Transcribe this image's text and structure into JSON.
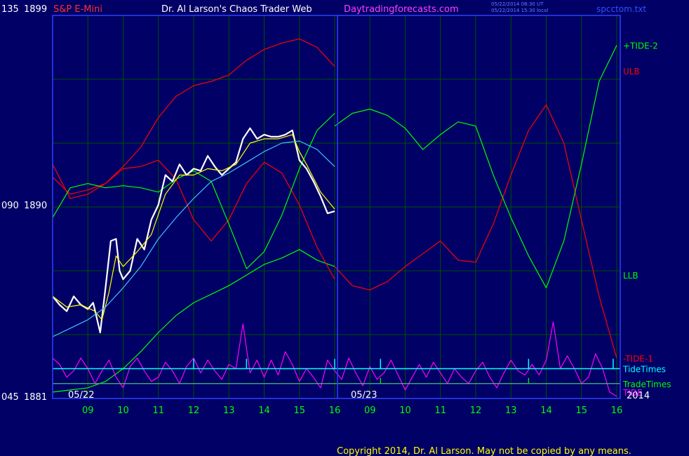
{
  "header": {
    "instrument": "S&P E-Mini",
    "title": "Dr. Al Larson's Chaos Trader Web",
    "site": "Daytradingforecasts.com",
    "timestamp1": "05/22/2014 08:30 UT",
    "timestamp2": "05/22/2014 15:30 local",
    "file": "spcctom.txt"
  },
  "copyright": "Copyright 2014, Dr. Al Larson. May not be copied by any means.",
  "colors": {
    "background": "#000066",
    "grid": "#005000",
    "frame": "#3040ff",
    "red": "#ff0000",
    "green": "#00ff00",
    "magenta": "#ff00ff",
    "cyan": "#00ffff",
    "white": "#ffffff",
    "yellow": "#ffff00",
    "lightblue": "#40c0ff",
    "label_white": "#ffffff"
  },
  "chart_data": {
    "type": "line",
    "ylim": [
      1881,
      1899
    ],
    "y_tick_labels": [
      {
        "value": 1899,
        "code": "135",
        "label": "1899"
      },
      {
        "value": 1890,
        "code": "090",
        "label": "1890"
      },
      {
        "value": 1881,
        "code": "045",
        "label": "1881"
      }
    ],
    "x_range": [
      8.1,
      16.1
    ],
    "x_tick_labels": [
      "09",
      "10",
      "11",
      "12",
      "13",
      "14",
      "15",
      "16",
      "09",
      "10",
      "11",
      "12",
      "13",
      "14",
      "15",
      "16"
    ],
    "date_labels": [
      "05/22",
      "05/23"
    ],
    "year_label": "2014",
    "right_labels": [
      {
        "text": "+TIDE-2",
        "color": "green",
        "y": 1897.6
      },
      {
        "text": "ULB",
        "color": "red",
        "y": 1896.4
      },
      {
        "text": "LLB",
        "color": "green",
        "y": 1886.8
      },
      {
        "text": "-TIDE-1",
        "color": "red",
        "y": 1882.9
      },
      {
        "text": "TideTimes",
        "color": "cyan",
        "y": 1882.4
      },
      {
        "text": "TradeTimes",
        "color": "green",
        "y": 1881.7
      },
      {
        "text": "TIDE",
        "color": "magenta",
        "y": 1881.3
      }
    ],
    "series": [
      {
        "name": "ULB",
        "color": "red",
        "x": [
          8.0,
          8.5,
          9.0,
          9.5,
          10.0,
          10.5,
          11.0,
          11.5,
          12.0,
          12.5,
          13.0,
          13.5,
          14.0,
          14.5,
          15.0,
          15.5,
          16.0
        ],
        "y": [
          1892.0,
          1890.4,
          1890.6,
          1891.1,
          1891.9,
          1892.8,
          1894.2,
          1895.2,
          1895.7,
          1895.9,
          1896.2,
          1896.9,
          1897.4,
          1897.7,
          1897.9,
          1897.5,
          1896.6
        ]
      },
      {
        "name": "LLB",
        "color": "green",
        "x": [
          8.0,
          8.5,
          9.0,
          9.5,
          10.0,
          10.5,
          11.0,
          11.5,
          12.0,
          12.5,
          13.0,
          13.5,
          14.0,
          14.5,
          15.0,
          15.5,
          16.0
        ],
        "y": [
          1881.3,
          1881.4,
          1881.5,
          1881.8,
          1882.4,
          1883.2,
          1884.1,
          1884.9,
          1885.5,
          1885.9,
          1886.3,
          1886.8,
          1887.3,
          1887.6,
          1888.0,
          1887.5,
          1887.2
        ]
      },
      {
        "name": "LLB (forecast)",
        "color": "red",
        "x": [
          16.0,
          16.5,
          17.0,
          17.5,
          18.0,
          18.5,
          19.0,
          19.5,
          20.0,
          20.5,
          21.0,
          21.5,
          22.0,
          22.5,
          23.0,
          23.5,
          24.0
        ],
        "y": [
          1887.2,
          1886.3,
          1886.1,
          1886.5,
          1887.2,
          1887.8,
          1888.4,
          1887.5,
          1887.4,
          1889.2,
          1891.5,
          1893.6,
          1894.8,
          1893.0,
          1889.4,
          1885.8,
          1882.9
        ]
      },
      {
        "name": "+TIDE-2 (forecast)",
        "color": "green",
        "x": [
          16.0,
          16.5,
          17.0,
          17.5,
          18.0,
          18.5,
          19.0,
          19.5,
          20.0,
          20.5,
          21.0,
          21.5,
          22.0,
          22.5,
          23.0,
          23.5,
          24.0
        ],
        "y": [
          1893.8,
          1894.4,
          1894.6,
          1894.3,
          1893.7,
          1892.7,
          1893.4,
          1894.0,
          1893.8,
          1891.5,
          1889.5,
          1887.7,
          1886.2,
          1888.4,
          1892.0,
          1895.9,
          1897.6
        ]
      },
      {
        "name": "TIDE-1",
        "color": "red",
        "x": [
          8.0,
          8.5,
          9.0,
          9.5,
          10.0,
          10.5,
          11.0,
          11.5,
          12.0,
          12.5,
          13.0,
          13.5,
          14.0,
          14.5,
          15.0,
          15.5,
          16.0
        ],
        "y": [
          1891.4,
          1890.6,
          1890.8,
          1891.1,
          1891.8,
          1891.9,
          1892.2,
          1891.3,
          1889.4,
          1888.4,
          1889.4,
          1891.1,
          1892.1,
          1891.6,
          1890.1,
          1888.1,
          1886.6
        ]
      },
      {
        "name": "TIDE-2",
        "color": "green",
        "x": [
          8.0,
          8.5,
          9.0,
          9.5,
          10.0,
          10.5,
          11.0,
          11.5,
          12.0,
          12.5,
          13.0,
          13.5,
          14.0,
          14.5,
          15.0,
          15.5,
          16.0
        ],
        "y": [
          1889.5,
          1890.9,
          1891.1,
          1890.9,
          1891.0,
          1890.9,
          1890.7,
          1891.3,
          1891.7,
          1891.2,
          1889.2,
          1887.1,
          1887.9,
          1889.6,
          1891.8,
          1893.6,
          1894.4
        ]
      },
      {
        "name": "Price",
        "color": "white",
        "x": [
          8.0,
          8.2,
          8.4,
          8.6,
          8.8,
          9.0,
          9.15,
          9.25,
          9.35,
          9.5,
          9.65,
          9.8,
          9.9,
          10.0,
          10.2,
          10.4,
          10.6,
          10.8,
          11.0,
          11.2,
          11.4,
          11.6,
          11.8,
          12.0,
          12.2,
          12.4,
          12.6,
          12.8,
          13.0,
          13.2,
          13.4,
          13.6,
          13.8,
          14.0,
          14.2,
          14.4,
          14.6,
          14.8,
          15.0,
          15.2,
          15.4,
          15.6,
          15.8,
          16.0
        ],
        "y": [
          1885.8,
          1885.4,
          1885.1,
          1885.8,
          1885.4,
          1885.2,
          1885.5,
          1884.8,
          1884.1,
          1886.2,
          1888.4,
          1888.5,
          1887.0,
          1886.6,
          1887.0,
          1888.5,
          1888.0,
          1889.4,
          1890.1,
          1891.5,
          1891.2,
          1892.0,
          1891.5,
          1891.8,
          1891.7,
          1892.4,
          1891.9,
          1891.5,
          1891.8,
          1892.1,
          1893.2,
          1893.7,
          1893.2,
          1893.4,
          1893.3,
          1893.3,
          1893.4,
          1893.6,
          1892.2,
          1891.8,
          1891.2,
          1890.5,
          1889.7,
          1889.8
        ]
      },
      {
        "name": "Fast average",
        "color": "yellow",
        "x": [
          8.0,
          8.4,
          8.8,
          9.2,
          9.4,
          9.6,
          9.8,
          10.0,
          10.4,
          10.8,
          11.2,
          11.6,
          12.0,
          12.4,
          12.8,
          13.2,
          13.6,
          14.0,
          14.4,
          14.8,
          15.0,
          15.2,
          15.6,
          16.0
        ],
        "y": [
          1885.8,
          1885.3,
          1885.4,
          1885.1,
          1884.7,
          1886.0,
          1887.7,
          1887.2,
          1887.9,
          1888.7,
          1890.6,
          1891.5,
          1891.5,
          1891.8,
          1891.7,
          1892.0,
          1893.0,
          1893.2,
          1893.2,
          1893.4,
          1892.6,
          1892.0,
          1890.7,
          1889.9
        ]
      },
      {
        "name": "Slow average",
        "color": "lightblue",
        "x": [
          8.0,
          8.5,
          9.0,
          9.5,
          10.0,
          10.5,
          11.0,
          11.5,
          12.0,
          12.5,
          13.0,
          13.5,
          14.0,
          14.5,
          15.0,
          15.5,
          16.0
        ],
        "y": [
          1883.9,
          1884.3,
          1884.7,
          1885.3,
          1886.2,
          1887.2,
          1888.5,
          1889.5,
          1890.4,
          1891.2,
          1891.6,
          1892.1,
          1892.6,
          1893.0,
          1893.1,
          1892.7,
          1891.9
        ]
      },
      {
        "name": "TIDE",
        "color": "magenta",
        "x": [
          8.0,
          8.2,
          8.4,
          8.6,
          8.8,
          9.0,
          9.2,
          9.4,
          9.6,
          9.8,
          10.0,
          10.2,
          10.4,
          10.6,
          10.8,
          11.0,
          11.2,
          11.4,
          11.6,
          11.8,
          12.0,
          12.2,
          12.4,
          12.6,
          12.8,
          13.0,
          13.2,
          13.4,
          13.6,
          13.8,
          14.0,
          14.2,
          14.4,
          14.6,
          14.8,
          15.0,
          15.2,
          15.4,
          15.6,
          15.8,
          16.0,
          16.2,
          16.4,
          16.6,
          16.8,
          17.0,
          17.2,
          17.4,
          17.6,
          17.8,
          18.0,
          18.2,
          18.4,
          18.6,
          18.8,
          19.0,
          19.2,
          19.4,
          19.6,
          19.8,
          20.0,
          20.2,
          20.4,
          20.6,
          20.8,
          21.0,
          21.2,
          21.4,
          21.6,
          21.8,
          22.0,
          22.2,
          22.4,
          22.6,
          22.8,
          23.0,
          23.2,
          23.4,
          23.6,
          23.8,
          24.0
        ],
        "y": [
          1882.9,
          1882.6,
          1882.0,
          1882.3,
          1882.9,
          1882.4,
          1881.7,
          1882.3,
          1882.8,
          1882.0,
          1881.5,
          1882.5,
          1882.9,
          1882.3,
          1881.8,
          1882.0,
          1882.7,
          1882.3,
          1881.7,
          1882.5,
          1882.9,
          1882.2,
          1882.8,
          1882.3,
          1881.9,
          1882.6,
          1882.4,
          1884.5,
          1882.2,
          1882.8,
          1882.0,
          1882.8,
          1882.1,
          1883.2,
          1882.6,
          1881.8,
          1882.4,
          1882.0,
          1881.5,
          1882.8,
          1882.3,
          1881.9,
          1882.9,
          1882.2,
          1881.6,
          1882.5,
          1881.9,
          1882.2,
          1882.8,
          1882.1,
          1881.4,
          1882.0,
          1882.6,
          1882.0,
          1882.7,
          1882.2,
          1881.7,
          1882.4,
          1882.0,
          1881.7,
          1882.3,
          1882.7,
          1882.0,
          1881.5,
          1882.2,
          1882.8,
          1882.3,
          1882.1,
          1882.6,
          1882.1,
          1882.8,
          1884.6,
          1882.4,
          1883.0,
          1882.4,
          1881.7,
          1882.0,
          1883.1,
          1882.4,
          1881.3,
          1881.1
        ]
      }
    ],
    "tide_times": [
      12.0,
      13.5,
      16.0,
      17.3,
      21.5,
      23.9
    ],
    "trade_times": [
      17.3,
      21.5
    ]
  }
}
